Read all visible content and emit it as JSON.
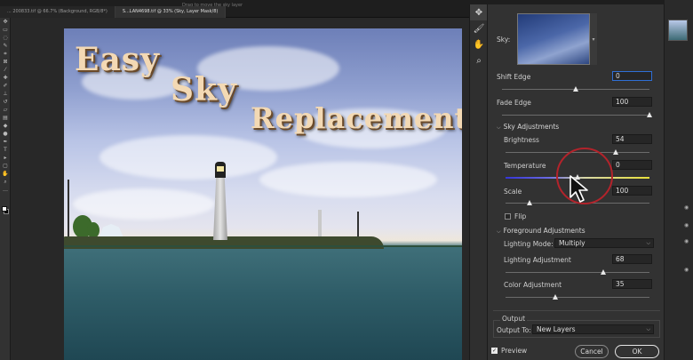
{
  "app": {
    "hint_text": "Drag to move the sky layer",
    "tabs": [
      {
        "label": "... 200833.tif @ 66.7% (Background, RGB/8*)"
      },
      {
        "label": "S...LAN4698.tif @ 33% (Sky, Layer Mask/8)"
      }
    ]
  },
  "canvas": {
    "overlay_words": [
      "Easy",
      "Sky",
      "Replacement"
    ]
  },
  "dialog": {
    "sky_label": "Sky:",
    "shift_edge": {
      "label": "Shift Edge",
      "value": "0",
      "slider": 0.5
    },
    "fade_edge": {
      "label": "Fade Edge",
      "value": "100",
      "slider": 1.0
    },
    "sky_adjustments": {
      "title": "Sky Adjustments",
      "brightness": {
        "label": "Brightness",
        "value": "54",
        "slider": 0.77
      },
      "temperature": {
        "label": "Temperature",
        "value": "0",
        "slider": 0.5
      },
      "scale": {
        "label": "Scale",
        "value": "100",
        "slider": 0.17
      },
      "flip": {
        "label": "Flip",
        "checked": false
      }
    },
    "foreground_adjustments": {
      "title": "Foreground Adjustments",
      "lighting_mode": {
        "label": "Lighting Mode:",
        "value": "Multiply"
      },
      "lighting_adjustment": {
        "label": "Lighting Adjustment",
        "value": "68",
        "slider": 0.68
      },
      "color_adjustment": {
        "label": "Color Adjustment",
        "value": "35",
        "slider": 0.35
      }
    },
    "output": {
      "title": "Output",
      "output_to_label": "Output To:",
      "output_to_value": "New Layers"
    },
    "preview": {
      "label": "Preview",
      "checked": true
    },
    "cancel_label": "Cancel",
    "ok_label": "OK"
  },
  "colors": {
    "annotation_circle": "#b3232b",
    "focus_blue": "#2f6fd6",
    "title_text": "#f3d9b4"
  },
  "icons": {
    "minitools": [
      "move-icon",
      "brush-icon",
      "hand-icon",
      "zoom-icon"
    ]
  }
}
